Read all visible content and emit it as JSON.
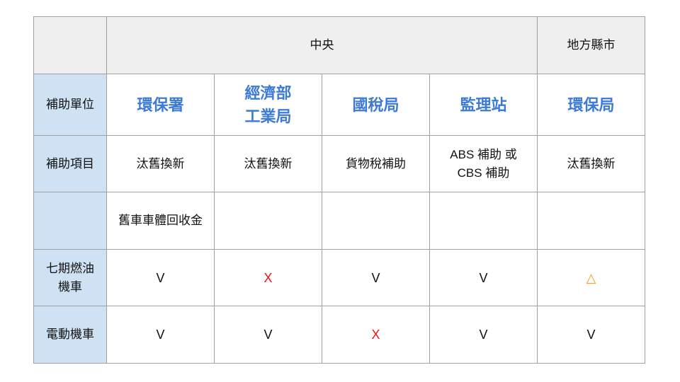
{
  "table": {
    "group_header": {
      "corner": "",
      "central": "中央",
      "local": "地方縣市"
    },
    "rows": [
      {
        "label": "補助單位",
        "cells": [
          "環保署",
          "經濟部\n工業局",
          "國稅局",
          "監理站",
          "環保局"
        ]
      },
      {
        "label": "補助項目",
        "cells": [
          "汰舊換新",
          "汰舊換新",
          "貨物稅補助",
          "ABS 補助 或\nCBS 補助",
          "汰舊換新"
        ]
      },
      {
        "label": "",
        "cells": [
          "舊車車體回收金",
          "",
          "",
          "",
          ""
        ]
      },
      {
        "label": "七期燃油\n機車",
        "cells": [
          "V",
          "X",
          "V",
          "V",
          "△"
        ]
      },
      {
        "label": "電動機車",
        "cells": [
          "V",
          "V",
          "X",
          "V",
          "V"
        ]
      }
    ]
  },
  "colors": {
    "agency_text": "#3d7ad6",
    "label_background": "#cfe2f3",
    "header_background": "#efefef",
    "not_eligible": "#ee1111",
    "partial": "#f39c12"
  }
}
